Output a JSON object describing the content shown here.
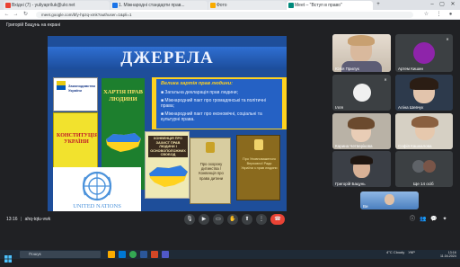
{
  "browser": {
    "tabs": [
      {
        "label": "Вхідні (7) - yuliyapriluk@ukr.net",
        "color": "#ea4335"
      },
      {
        "label": "1. Міжнародні стандарти прав...",
        "color": "#1a73e8"
      },
      {
        "label": "Фото",
        "color": "#f9ab00"
      },
      {
        "label": "Meet – \"Вступ в право\"",
        "color": "#00897b"
      }
    ],
    "url": "meet.google.com/bfy-hpzq-xmk?authuser=1&pli=1",
    "window_controls": [
      "–",
      "▢",
      "✕"
    ]
  },
  "meet": {
    "presenter_label": "Григорій Бацунь на екрані",
    "meeting_time": "13:16",
    "meeting_code": "ahq-tqtu-vwk"
  },
  "slide": {
    "title": "ДЖЕРЕЛА",
    "book_laws_title": "Законодавство України",
    "book_constitution_title": "КОНСТИТУЦІЯ УКРАЇНИ",
    "book_charter_title": "ХАРТІЯ ПРАВ ЛЮДИНИ",
    "book_convention_title": "КОНВЕНЦІЯ ПРО ЗАХИСТ ПРАВ ЛЮДИНИ І ОСНОВОПОЛОЖНИХ СВОБОД",
    "book_child1_title": "Про охорону дитинства / Конвенція про права дитини",
    "book_child2_title": "Про Уповноваженого Верховної Ради України з прав людини",
    "un_label": "UNITED NATIONS",
    "quote_title": "Велика хартія прав людини:",
    "quote_lines": [
      "■ Загальна декларація прав людини;",
      "■ Міжнародний пакт про громадянські та політичні права;",
      "■ Міжнародний пакт про економічні, соціальні та культурні права."
    ]
  },
  "participants": [
    {
      "name": "Юлія Прилук",
      "tile": "photo-woman-blonde"
    },
    {
      "name": "Артем Кишин",
      "tile": "avatar-a"
    },
    {
      "name": "Ілля",
      "tile": "avatar-i"
    },
    {
      "name": "Карина Четверікова",
      "tile": "photo-room"
    },
    {
      "name": "Аліна Шевчук",
      "tile": "photo-woman-dark"
    },
    {
      "name": "Софія Кашкалова",
      "tile": "photo-woman-curly"
    },
    {
      "name": "Григорій Бацунь",
      "tile": "photo-man-glasses"
    },
    {
      "name": "Аліна Бронз",
      "tile": "photo-woman-laptop"
    },
    {
      "name": "Ще 14 осіб",
      "tile": "more"
    },
    {
      "name": "Ви",
      "tile": "photo-self"
    }
  ],
  "taskbar": {
    "search_placeholder": "Пошук",
    "weather": "4°C Cloudy",
    "language": "УКР",
    "time": "13:16",
    "date": "11.04.2024"
  },
  "colors": {
    "meet_bg": "#202124",
    "end_call": "#ea4335",
    "slide_blue": "#1e4e9a",
    "slide_yellow": "#ffd21f"
  }
}
